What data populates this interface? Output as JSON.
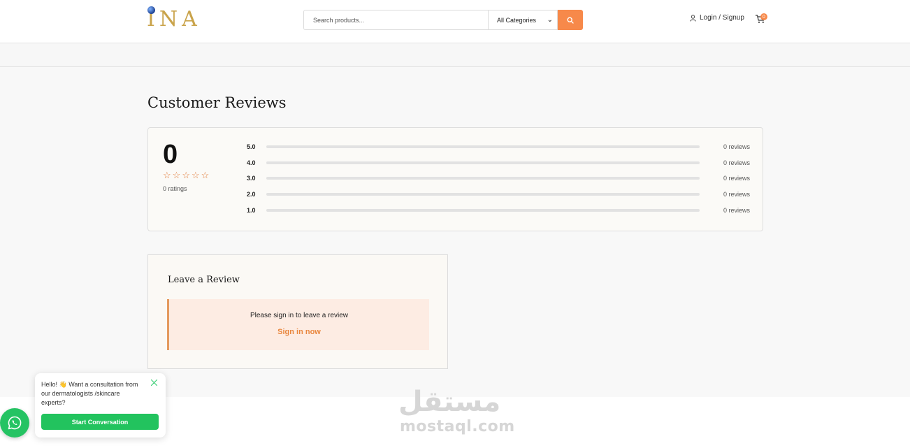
{
  "header": {
    "logo_text": "INA",
    "search_placeholder": "Search products...",
    "category_selected": "All Categories",
    "login_label": "Login / Signup",
    "cart_count": "0",
    "accent_color": "#f7894a"
  },
  "reviews": {
    "title": "Customer Reviews",
    "average": "0",
    "stars_filled": 0,
    "stars_total": 5,
    "ratings_label": "0 ratings",
    "distribution": [
      {
        "label": "5.0",
        "count": "0 reviews",
        "fraction": 0
      },
      {
        "label": "4.0",
        "count": "0 reviews",
        "fraction": 0
      },
      {
        "label": "3.0",
        "count": "0 reviews",
        "fraction": 0
      },
      {
        "label": "2.0",
        "count": "0 reviews",
        "fraction": 0
      },
      {
        "label": "1.0",
        "count": "0 reviews",
        "fraction": 0
      }
    ]
  },
  "leave_review": {
    "title": "Leave a Review",
    "message": "Please sign in to leave a review",
    "link": "Sign in now"
  },
  "chat": {
    "message": "Hello! 👋 Want a consultation from our dermatologists /skincare experts?",
    "button": "Start Conversation",
    "close_icon": "close-icon",
    "whatsapp_icon": "whatsapp-icon"
  },
  "watermark": {
    "arabic": "مستقل",
    "latin": "mostaql.com"
  }
}
